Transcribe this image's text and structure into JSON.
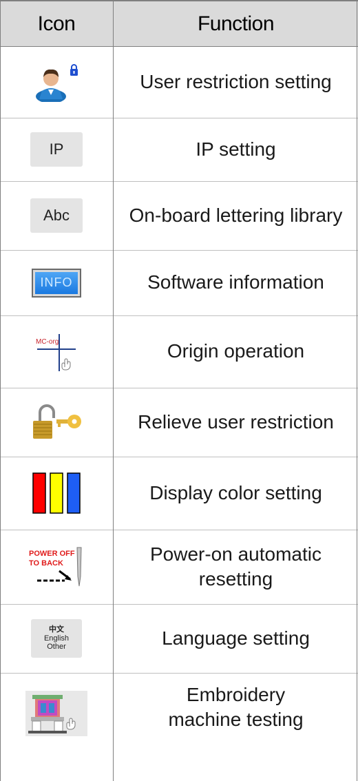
{
  "header": {
    "icon": "Icon",
    "function": "Function"
  },
  "rows": [
    {
      "icon": "user-lock-icon",
      "function": "User restriction setting"
    },
    {
      "icon": "ip-button-icon",
      "icon_text": "IP",
      "function": "IP setting"
    },
    {
      "icon": "abc-button-icon",
      "icon_text": "Abc",
      "function": "On-board lettering library"
    },
    {
      "icon": "info-button-icon",
      "icon_text": "INFO",
      "function": "Software information"
    },
    {
      "icon": "mc-org-crosshair-icon",
      "icon_text": "MC-org",
      "function": "Origin operation"
    },
    {
      "icon": "padlock-key-icon",
      "function": "Relieve user restriction"
    },
    {
      "icon": "color-bars-icon",
      "function": "Display color setting",
      "colors": [
        "#ff0000",
        "#ffff00",
        "#1e5ef5"
      ]
    },
    {
      "icon": "power-off-needle-icon",
      "icon_text_1": "POWER OFF",
      "icon_text_2": "TO BACK",
      "function": "Power-on automatic resetting"
    },
    {
      "icon": "language-button-icon",
      "icon_text_1": "中文",
      "icon_text_2": "English",
      "icon_text_3": "Other",
      "function": "Language setting"
    },
    {
      "icon": "embroidery-machine-icon",
      "function": "Embroidery machine testing"
    }
  ]
}
